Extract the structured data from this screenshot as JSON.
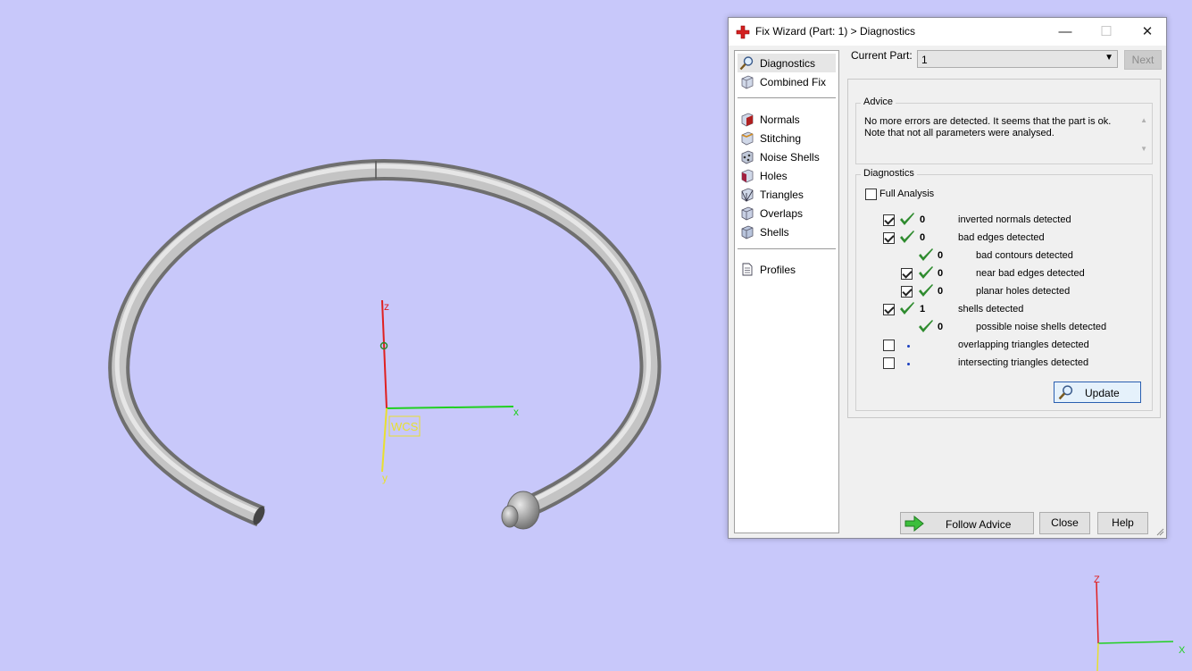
{
  "viewport": {
    "axis_z": "z",
    "axis_x": "x",
    "axis_y": "y",
    "wcs_label": "WCS",
    "mini_axis_z": "Z",
    "mini_axis_x": "X"
  },
  "window": {
    "title": "Fix Wizard (Part: 1) > Diagnostics",
    "minimize": "—",
    "maximize": "☐",
    "close": "✕"
  },
  "sidebar": {
    "items": [
      {
        "label": "Diagnostics",
        "icon": "magnifier-icon"
      },
      {
        "label": "Combined Fix",
        "icon": "cube-icon"
      },
      {
        "label": "Normals",
        "icon": "normals-cube-icon"
      },
      {
        "label": "Stitching",
        "icon": "stitching-cube-icon"
      },
      {
        "label": "Noise Shells",
        "icon": "noise-shells-icon"
      },
      {
        "label": "Holes",
        "icon": "holes-cube-icon"
      },
      {
        "label": "Triangles",
        "icon": "triangles-cube-icon"
      },
      {
        "label": "Overlaps",
        "icon": "overlaps-cube-icon"
      },
      {
        "label": "Shells",
        "icon": "shells-cube-icon"
      },
      {
        "label": "Profiles",
        "icon": "document-icon"
      }
    ]
  },
  "current_part": {
    "label": "Current Part:",
    "value": "1",
    "next": "Next"
  },
  "advice": {
    "title": "Advice",
    "line1": "No more errors are detected. It seems that the part is ok.",
    "line2": "Note that not all parameters were analysed."
  },
  "diagnostics": {
    "title": "Diagnostics",
    "full_analysis": "Full Analysis",
    "rows": [
      {
        "checked": true,
        "ok": true,
        "count": "0",
        "text": "inverted normals detected"
      },
      {
        "checked": true,
        "ok": true,
        "count": "0",
        "text": "bad edges detected"
      },
      {
        "checked": null,
        "ok": true,
        "count": "0",
        "text": "bad contours detected"
      },
      {
        "checked": true,
        "ok": true,
        "count": "0",
        "text": "near bad edges detected"
      },
      {
        "checked": true,
        "ok": true,
        "count": "0",
        "text": "planar holes detected"
      },
      {
        "checked": true,
        "ok": true,
        "count": "1",
        "text": "shells detected"
      },
      {
        "checked": null,
        "ok": true,
        "count": "0",
        "text": "possible noise shells detected"
      },
      {
        "checked": false,
        "ok": false,
        "count": "",
        "text": "overlapping triangles detected"
      },
      {
        "checked": false,
        "ok": false,
        "count": "",
        "text": "intersecting triangles detected"
      }
    ],
    "update": "Update"
  },
  "footer": {
    "follow_advice": "Follow Advice",
    "close": "Close",
    "help": "Help"
  },
  "colors": {
    "background": "#c8c8fa",
    "tick_green": "#2e8b2e",
    "axis_red": "#e02020",
    "axis_green": "#20d020",
    "axis_yellow": "#e8e030"
  }
}
